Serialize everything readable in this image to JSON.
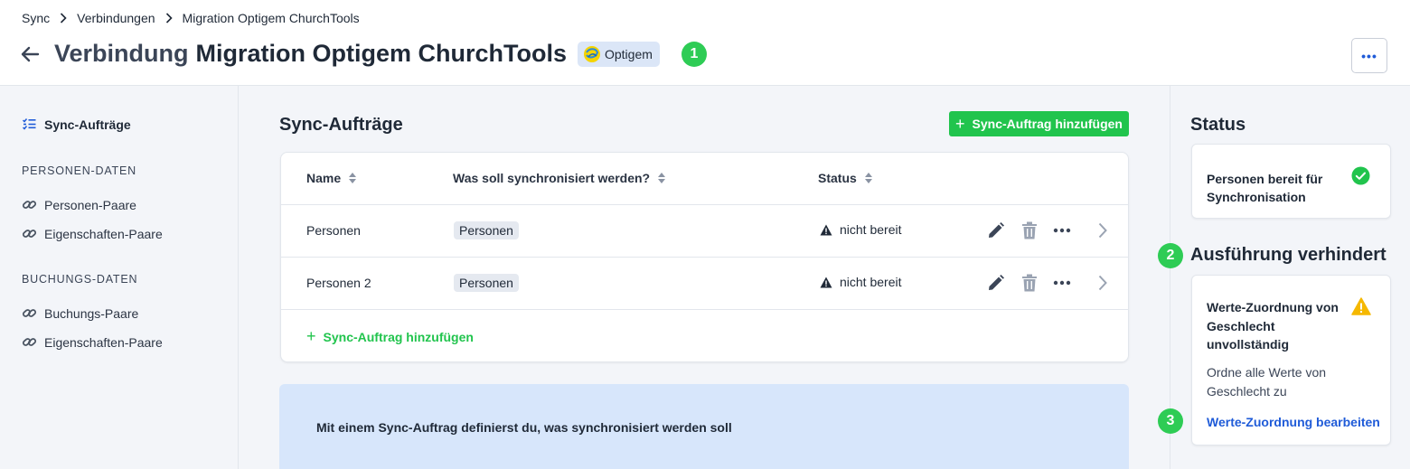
{
  "breadcrumb": [
    "Sync",
    "Verbindungen",
    "Migration Optigem ChurchTools"
  ],
  "header": {
    "title_prefix": "Verbindung",
    "title_name": "Migration Optigem ChurchTools",
    "badge": "Optigem",
    "menu_label": "•••"
  },
  "markers": [
    "1",
    "2",
    "3"
  ],
  "sidebar": {
    "active": "Sync-Aufträge",
    "sections": [
      {
        "title": "PERSONEN-DATEN",
        "items": [
          "Personen-Paare",
          "Eigenschaften-Paare"
        ]
      },
      {
        "title": "BUCHUNGS-DATEN",
        "items": [
          "Buchungs-Paare",
          "Eigenschaften-Paare"
        ]
      }
    ]
  },
  "main": {
    "title": "Sync-Aufträge",
    "add_button": "Sync-Auftrag hinzufügen",
    "columns": [
      "Name",
      "Was soll synchronisiert werden?",
      "Status"
    ],
    "rows": [
      {
        "name": "Personen",
        "what": "Personen",
        "status": "nicht bereit"
      },
      {
        "name": "Personen 2",
        "what": "Personen",
        "status": "nicht bereit"
      }
    ],
    "add_link": "Sync-Auftrag hinzufügen",
    "info": "Mit einem Sync-Auftrag definierst du, was synchronisiert werden soll"
  },
  "right": {
    "status_title": "Status",
    "status_text": "Personen bereit für Synchronisation",
    "blocked_title": "Ausführung verhindert",
    "warn_title": "Werte-Zuordnung von Geschlecht unvollständig",
    "warn_desc": "Ordne alle Werte von Geschlecht zu",
    "warn_link": "Werte-Zuordnung bearbeiten"
  },
  "colors": {
    "accent_green": "#21c44d",
    "marker_green": "#2ecc55",
    "link_blue": "#1f5bd8",
    "warn_yellow": "#f5b800",
    "info_bg": "#d7e6fb"
  }
}
